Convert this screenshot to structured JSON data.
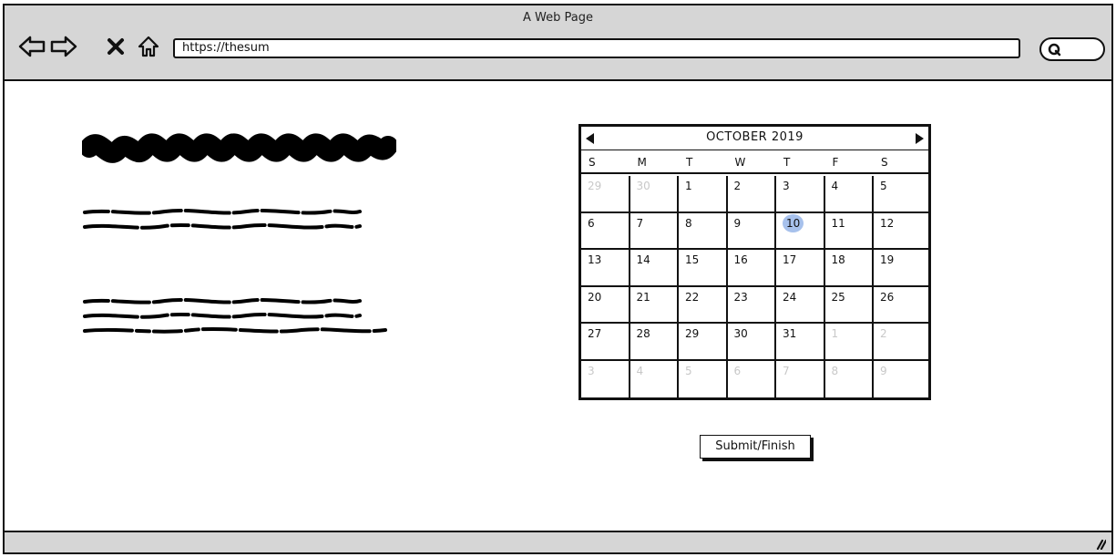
{
  "window": {
    "title": "A Web Page"
  },
  "nav": {
    "back_icon": "back-arrow-icon",
    "forward_icon": "forward-arrow-icon",
    "stop_icon": "close-icon",
    "home_icon": "home-icon"
  },
  "address_bar": {
    "value": "https://thesum"
  },
  "search": {
    "icon": "search-icon"
  },
  "calendar": {
    "title": "OCTOBER 2019",
    "weekdays": [
      "S",
      "M",
      "T",
      "W",
      "T",
      "F",
      "S"
    ],
    "selected_day": "10",
    "weeks": [
      [
        "29",
        "30",
        "1",
        "2",
        "3",
        "4",
        "5"
      ],
      [
        "6",
        "7",
        "8",
        "9",
        "10",
        "11",
        "12"
      ],
      [
        "13",
        "14",
        "15",
        "16",
        "17",
        "18",
        "19"
      ],
      [
        "20",
        "21",
        "22",
        "23",
        "24",
        "25",
        "26"
      ],
      [
        "27",
        "28",
        "29",
        "30",
        "31",
        "1",
        "2"
      ],
      [
        "3",
        "4",
        "5",
        "6",
        "7",
        "8",
        "9"
      ]
    ],
    "muted": [
      [
        true,
        true,
        false,
        false,
        false,
        false,
        false
      ],
      [
        false,
        false,
        false,
        false,
        false,
        false,
        false
      ],
      [
        false,
        false,
        false,
        false,
        false,
        false,
        false
      ],
      [
        false,
        false,
        false,
        false,
        false,
        false,
        false
      ],
      [
        false,
        false,
        false,
        false,
        false,
        true,
        true
      ],
      [
        true,
        true,
        true,
        true,
        true,
        true,
        true
      ]
    ]
  },
  "actions": {
    "submit_label": "Submit/Finish"
  },
  "colors": {
    "chrome": "#d6d6d6",
    "selected": "#a7c1ec",
    "muted_text": "#c8c8c8"
  }
}
